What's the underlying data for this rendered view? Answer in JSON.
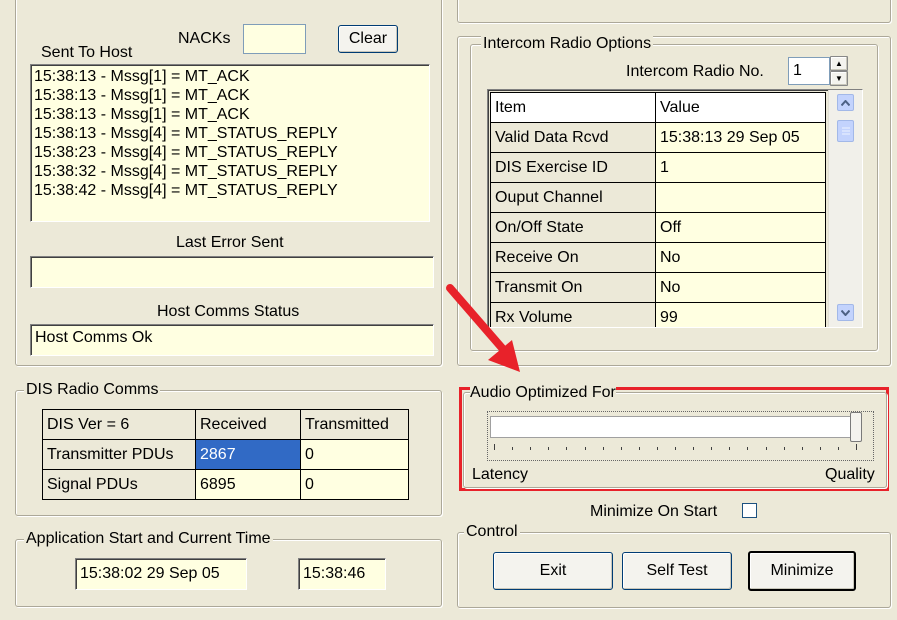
{
  "nacks": {
    "label": "NACKs",
    "value": ""
  },
  "clear_label": "Clear",
  "sent_to_host": {
    "label": "Sent To Host",
    "items": [
      "15:38:13  - Mssg[1] = MT_ACK",
      "15:38:13  - Mssg[1] = MT_ACK",
      "15:38:13  - Mssg[1] = MT_ACK",
      "15:38:13  - Mssg[4] = MT_STATUS_REPLY",
      "15:38:23  - Mssg[4] = MT_STATUS_REPLY",
      "15:38:32  - Mssg[4] = MT_STATUS_REPLY",
      "15:38:42  - Mssg[4] = MT_STATUS_REPLY"
    ]
  },
  "last_error": {
    "label": "Last Error Sent",
    "value": ""
  },
  "host_comms": {
    "label": "Host Comms Status",
    "value": "Host Comms Ok"
  },
  "dis_radio": {
    "title": "DIS Radio Comms",
    "headers": [
      "DIS Ver = 6",
      "Received",
      "Transmitted"
    ],
    "rows": [
      {
        "label": "Transmitter PDUs",
        "received": "2867",
        "transmitted": "0"
      },
      {
        "label": "Signal PDUs",
        "received": "6895",
        "transmitted": "0"
      }
    ]
  },
  "app_time": {
    "title": "Application Start and Current Time",
    "start": "15:38:02 29 Sep 05",
    "current": "15:38:46"
  },
  "intercom": {
    "title": "Intercom Radio Options",
    "radio_no_label": "Intercom Radio No.",
    "radio_no_value": "1",
    "headers": [
      "Item",
      "Value"
    ],
    "rows": [
      {
        "item": "Valid Data Rcvd",
        "value": "15:38:13 29 Sep 05"
      },
      {
        "item": "DIS Exercise ID",
        "value": "1"
      },
      {
        "item": "Ouput Channel",
        "value": ""
      },
      {
        "item": "On/Off State",
        "value": "Off"
      },
      {
        "item": "Receive On",
        "value": "No"
      },
      {
        "item": "Transmit On",
        "value": "No"
      },
      {
        "item": "Rx Volume",
        "value": "99"
      }
    ]
  },
  "audio": {
    "title": "Audio Optimized For",
    "min_label": "Latency",
    "max_label": "Quality",
    "slider_value": 1.0,
    "highlight_color": "#E8222A"
  },
  "minimize_on_start": {
    "label": "Minimize On Start",
    "checked": false
  },
  "control": {
    "title": "Control",
    "exit_label": "Exit",
    "self_test_label": "Self Test",
    "minimize_label": "Minimize"
  },
  "annotation": {
    "arrow_color": "#E8222A"
  }
}
